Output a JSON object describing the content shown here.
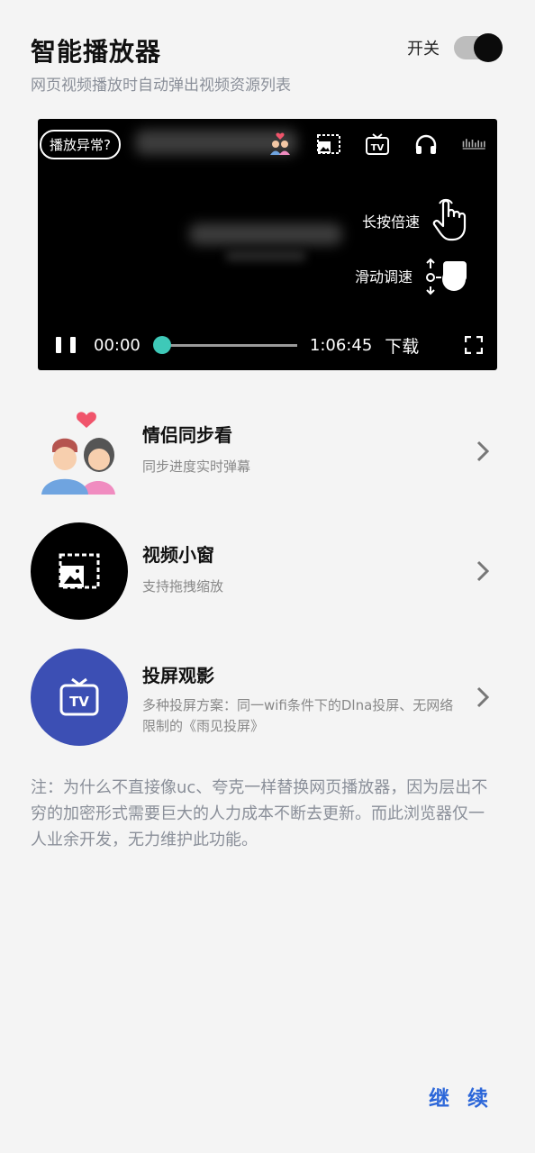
{
  "header": {
    "title": "智能播放器",
    "subtitle": "网页视频播放时自动弹出视频资源列表",
    "switch_label": "开关",
    "switch_on": true
  },
  "player": {
    "issue_button": "播放异常?",
    "long_press_hint": "长按倍速",
    "swipe_hint": "滑动调速",
    "time_current": "00:00",
    "time_total": "1:06:45",
    "download_label": "下载",
    "progress": 0,
    "accent_color": "#3ec9b8"
  },
  "features": [
    {
      "title": "情侣同步看",
      "desc": "同步进度实时弹幕",
      "icon": "couple-heart-icon"
    },
    {
      "title": "视频小窗",
      "desc": "支持拖拽缩放",
      "icon": "picture-in-picture-icon",
      "bg": "#000000"
    },
    {
      "title": "投屏观影",
      "desc": "多种投屏方案：同一wifi条件下的Dlna投屏、无网络限制的《雨见投屏》",
      "icon": "tv-icon",
      "bg": "#3c4fb4"
    }
  ],
  "note": "注：为什么不直接像uc、夸克一样替换网页播放器，因为层出不穷的加密形式需要巨大的人力成本不断去更新。而此浏览器仅一人业余开发，无力维护此功能。",
  "continue_label": "继 续",
  "colors": {
    "link": "#2b66d9",
    "background": "#f4f4f4"
  }
}
